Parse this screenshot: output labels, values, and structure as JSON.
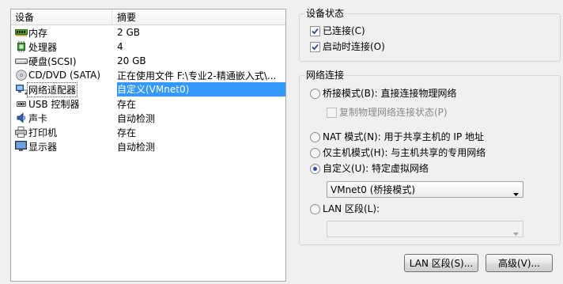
{
  "device_list": {
    "columns": {
      "device": "设备",
      "summary": "摘要"
    },
    "rows": [
      {
        "icon": "memory-icon",
        "name": "内存",
        "summary": "2 GB"
      },
      {
        "icon": "processor-icon",
        "name": "处理器",
        "summary": "4"
      },
      {
        "icon": "hard-disk-icon",
        "name": "硬盘(SCSI)",
        "summary": "20 GB"
      },
      {
        "icon": "cd-dvd-icon",
        "name": "CD/DVD (SATA)",
        "summary": "正在使用文件 F:\\专业2-精通嵌入式\\..."
      },
      {
        "icon": "network-adapter-icon",
        "name": "网络适配器",
        "summary": "自定义(VMnet0)",
        "selected": true
      },
      {
        "icon": "usb-icon",
        "name": "USB 控制器",
        "summary": "存在"
      },
      {
        "icon": "sound-card-icon",
        "name": "声卡",
        "summary": "自动检测"
      },
      {
        "icon": "printer-icon",
        "name": "打印机",
        "summary": "存在"
      },
      {
        "icon": "display-icon",
        "name": "显示器",
        "summary": "自动检测"
      }
    ],
    "selected_color": "#3399ff"
  },
  "device_status": {
    "title": "设备状态",
    "connected": {
      "label": "已连接(C)",
      "checked": true
    },
    "connect_at_power_on": {
      "label": "启动时连接(O)",
      "checked": true
    }
  },
  "network_connection": {
    "title": "网络连接",
    "bridged": {
      "label": "桥接模式(B): 直接连接物理网络",
      "selected": false
    },
    "replicate_state": {
      "label": "复制物理网络连接状态(P)",
      "checked": false,
      "disabled": true
    },
    "nat": {
      "label": "NAT 模式(N): 用于共享主机的 IP 地址",
      "selected": false
    },
    "host_only": {
      "label": "仅主机模式(H): 与主机共享的专用网络",
      "selected": false
    },
    "custom": {
      "label": "自定义(U): 特定虚拟网络",
      "selected": true
    },
    "custom_network_select": {
      "value": "VMnet0 (桥接模式)"
    },
    "lan_segment": {
      "label": "LAN 区段(L):",
      "selected": false
    },
    "lan_segment_select": {
      "value": "",
      "disabled": true
    }
  },
  "buttons": {
    "lan_segments": "LAN 区段(S)...",
    "advanced": "高级(V)..."
  }
}
